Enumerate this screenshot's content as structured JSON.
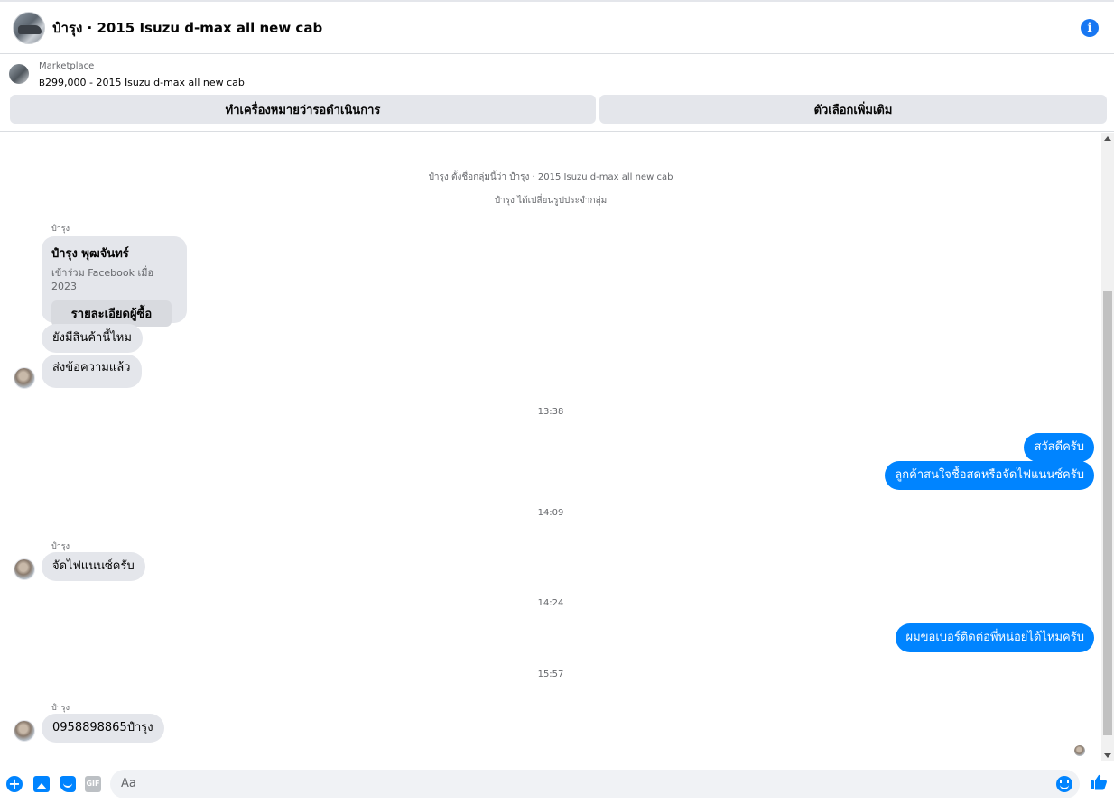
{
  "header": {
    "title": "ปำรุง · 2015 Isuzu d-max all new cab",
    "info_icon": "info-icon"
  },
  "marketplace": {
    "label": "Marketplace",
    "listing": "฿299,000 - 2015 Isuzu d-max all new cab",
    "mark_pending_button": "ทำเครื่องหมายว่ารอดำเนินการ",
    "more_options_button": "ตัวเลือกเพิ่มเติม"
  },
  "thread": {
    "system_messages": [
      "ปำรุง ตั้งชื่อกลุ่มนี้ว่า ปำรุง · 2015 Isuzu d-max all new cab",
      "ปำรุง ได้เปลี่ยนรูปประจำกลุ่ม"
    ],
    "buyer_card": {
      "sender": "ปำรุง",
      "name": "ปำรุง พุฒจันทร์",
      "joined": "เข้าร่วม Facebook เมื่อ 2023",
      "details_button": "รายละเอียดผู้ซื้อ"
    },
    "incoming_1": [
      "ยังมีสินค้านี้ไหม",
      "ส่งข้อความแล้ว"
    ],
    "time_1": "13:38",
    "outgoing_1": [
      "สวัสดีครับ",
      "ลูกค้าสนใจซื้อสดหรือจัดไฟแนนซ์ครับ"
    ],
    "time_2": "14:09",
    "sender_2": "ปำรุง",
    "incoming_2": "จัดไฟแนนซ์ครับ",
    "time_3": "14:24",
    "outgoing_2": "ผมขอเบอร์ติดต่อพี่หน่อยได้ไหมครับ",
    "time_4": "15:57",
    "sender_3": "ปำรุง",
    "incoming_3": "0958898865ปำรุง"
  },
  "composer": {
    "placeholder": "Aa",
    "gif_label": "GIF",
    "icons": [
      "plus-icon",
      "photo-icon",
      "sticker-icon",
      "gif-icon",
      "emoji-icon",
      "thumbs-up-icon"
    ]
  },
  "colors": {
    "accent": "#0084ff",
    "bubble_in": "#e4e6eb",
    "button_bg": "#e4e6eb"
  }
}
